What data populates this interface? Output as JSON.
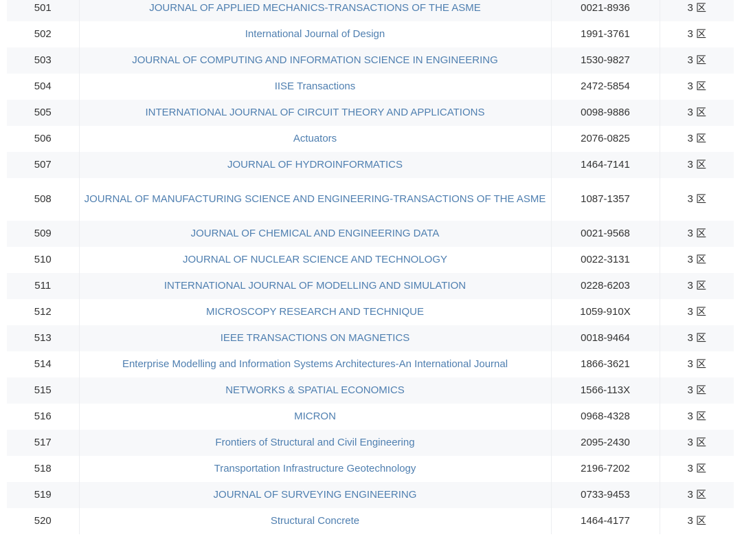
{
  "journals": [
    {
      "index": "501",
      "name": "JOURNAL OF APPLIED MECHANICS-TRANSACTIONS OF THE ASME",
      "issn": "0021-8936",
      "zone": "3 区"
    },
    {
      "index": "502",
      "name": "International Journal of Design",
      "issn": "1991-3761",
      "zone": "3 区"
    },
    {
      "index": "503",
      "name": "JOURNAL OF COMPUTING AND INFORMATION SCIENCE IN ENGINEERING",
      "issn": "1530-9827",
      "zone": "3 区"
    },
    {
      "index": "504",
      "name": "IISE Transactions",
      "issn": "2472-5854",
      "zone": "3 区"
    },
    {
      "index": "505",
      "name": "INTERNATIONAL JOURNAL OF CIRCUIT THEORY AND APPLICATIONS",
      "issn": "0098-9886",
      "zone": "3 区"
    },
    {
      "index": "506",
      "name": "Actuators",
      "issn": "2076-0825",
      "zone": "3 区"
    },
    {
      "index": "507",
      "name": "JOURNAL OF HYDROINFORMATICS",
      "issn": "1464-7141",
      "zone": "3 区"
    },
    {
      "index": "508",
      "name": "JOURNAL OF MANUFACTURING SCIENCE AND ENGINEERING-TRANSACTIONS OF THE ASME",
      "issn": "1087-1357",
      "zone": "3 区"
    },
    {
      "index": "509",
      "name": "JOURNAL OF CHEMICAL AND ENGINEERING DATA",
      "issn": "0021-9568",
      "zone": "3 区"
    },
    {
      "index": "510",
      "name": "JOURNAL OF NUCLEAR SCIENCE AND TECHNOLOGY",
      "issn": "0022-3131",
      "zone": "3 区"
    },
    {
      "index": "511",
      "name": "INTERNATIONAL JOURNAL OF MODELLING AND SIMULATION",
      "issn": "0228-6203",
      "zone": "3 区"
    },
    {
      "index": "512",
      "name": "MICROSCOPY RESEARCH AND TECHNIQUE",
      "issn": "1059-910X",
      "zone": "3 区"
    },
    {
      "index": "513",
      "name": "IEEE TRANSACTIONS ON MAGNETICS",
      "issn": "0018-9464",
      "zone": "3 区"
    },
    {
      "index": "514",
      "name": "Enterprise Modelling and Information Systems Architectures-An International Journal",
      "issn": "1866-3621",
      "zone": "3 区"
    },
    {
      "index": "515",
      "name": "NETWORKS & SPATIAL ECONOMICS",
      "issn": "1566-113X",
      "zone": "3 区"
    },
    {
      "index": "516",
      "name": "MICRON",
      "issn": "0968-4328",
      "zone": "3 区"
    },
    {
      "index": "517",
      "name": "Frontiers of Structural and Civil Engineering",
      "issn": "2095-2430",
      "zone": "3 区"
    },
    {
      "index": "518",
      "name": "Transportation Infrastructure Geotechnology",
      "issn": "2196-7202",
      "zone": "3 区"
    },
    {
      "index": "519",
      "name": "JOURNAL OF SURVEYING ENGINEERING",
      "issn": "0733-9453",
      "zone": "3 区"
    },
    {
      "index": "520",
      "name": "Structural Concrete",
      "issn": "1464-4177",
      "zone": "3 区"
    }
  ],
  "colors": {
    "link": "#4f7fb0",
    "text": "#333333",
    "stripe": "#f7f8fa",
    "divider": "#eceef1"
  }
}
